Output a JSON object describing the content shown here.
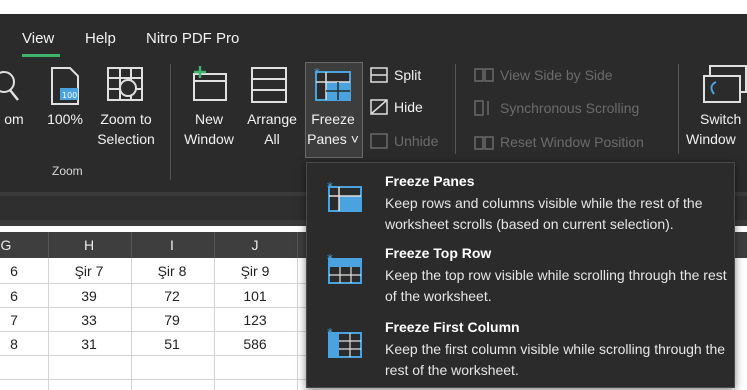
{
  "menu": {
    "tabs": [
      "View",
      "Help",
      "Nitro PDF Pro"
    ],
    "active_tab": "View"
  },
  "ribbon": {
    "zoom_partial": "om",
    "zoom100": "100%",
    "zoom_to_selection": [
      "Zoom to",
      "Selection"
    ],
    "zoom_group": "Zoom",
    "new_window": [
      "New",
      "Window"
    ],
    "arrange_all": [
      "Arrange",
      "All"
    ],
    "freeze_panes": [
      "Freeze",
      "Panes ˅"
    ],
    "split": "Split",
    "hide": "Hide",
    "unhide": "Unhide",
    "view_side_by_side": "View Side by Side",
    "synchronous_scrolling": "Synchronous Scrolling",
    "reset_window_position": "Reset Window Position",
    "switch_windows": [
      "Switch",
      "Window"
    ]
  },
  "sheet": {
    "columns": [
      "G",
      "H",
      "I",
      "J"
    ],
    "rows": [
      [
        "6",
        "Şir 7",
        "Şir 8",
        "Şir 9"
      ],
      [
        "6",
        "39",
        "72",
        "101"
      ],
      [
        "7",
        "33",
        "79",
        "123"
      ],
      [
        "8",
        "31",
        "51",
        "586"
      ]
    ]
  },
  "freeze_menu": {
    "items": [
      {
        "title": "Freeze Panes",
        "desc": "Keep rows and columns visible while the rest of the worksheet scrolls (based on current selection)."
      },
      {
        "title": "Freeze Top Row",
        "desc": "Keep the top row visible while scrolling through the rest of the worksheet."
      },
      {
        "title": "Freeze First Column",
        "desc": "Keep the first column visible while scrolling through the rest of the worksheet."
      }
    ]
  },
  "colors": {
    "accent": "#3fb56b",
    "ribbon_bg": "#2b2b2b",
    "icon_blue": "#4aa3df"
  }
}
